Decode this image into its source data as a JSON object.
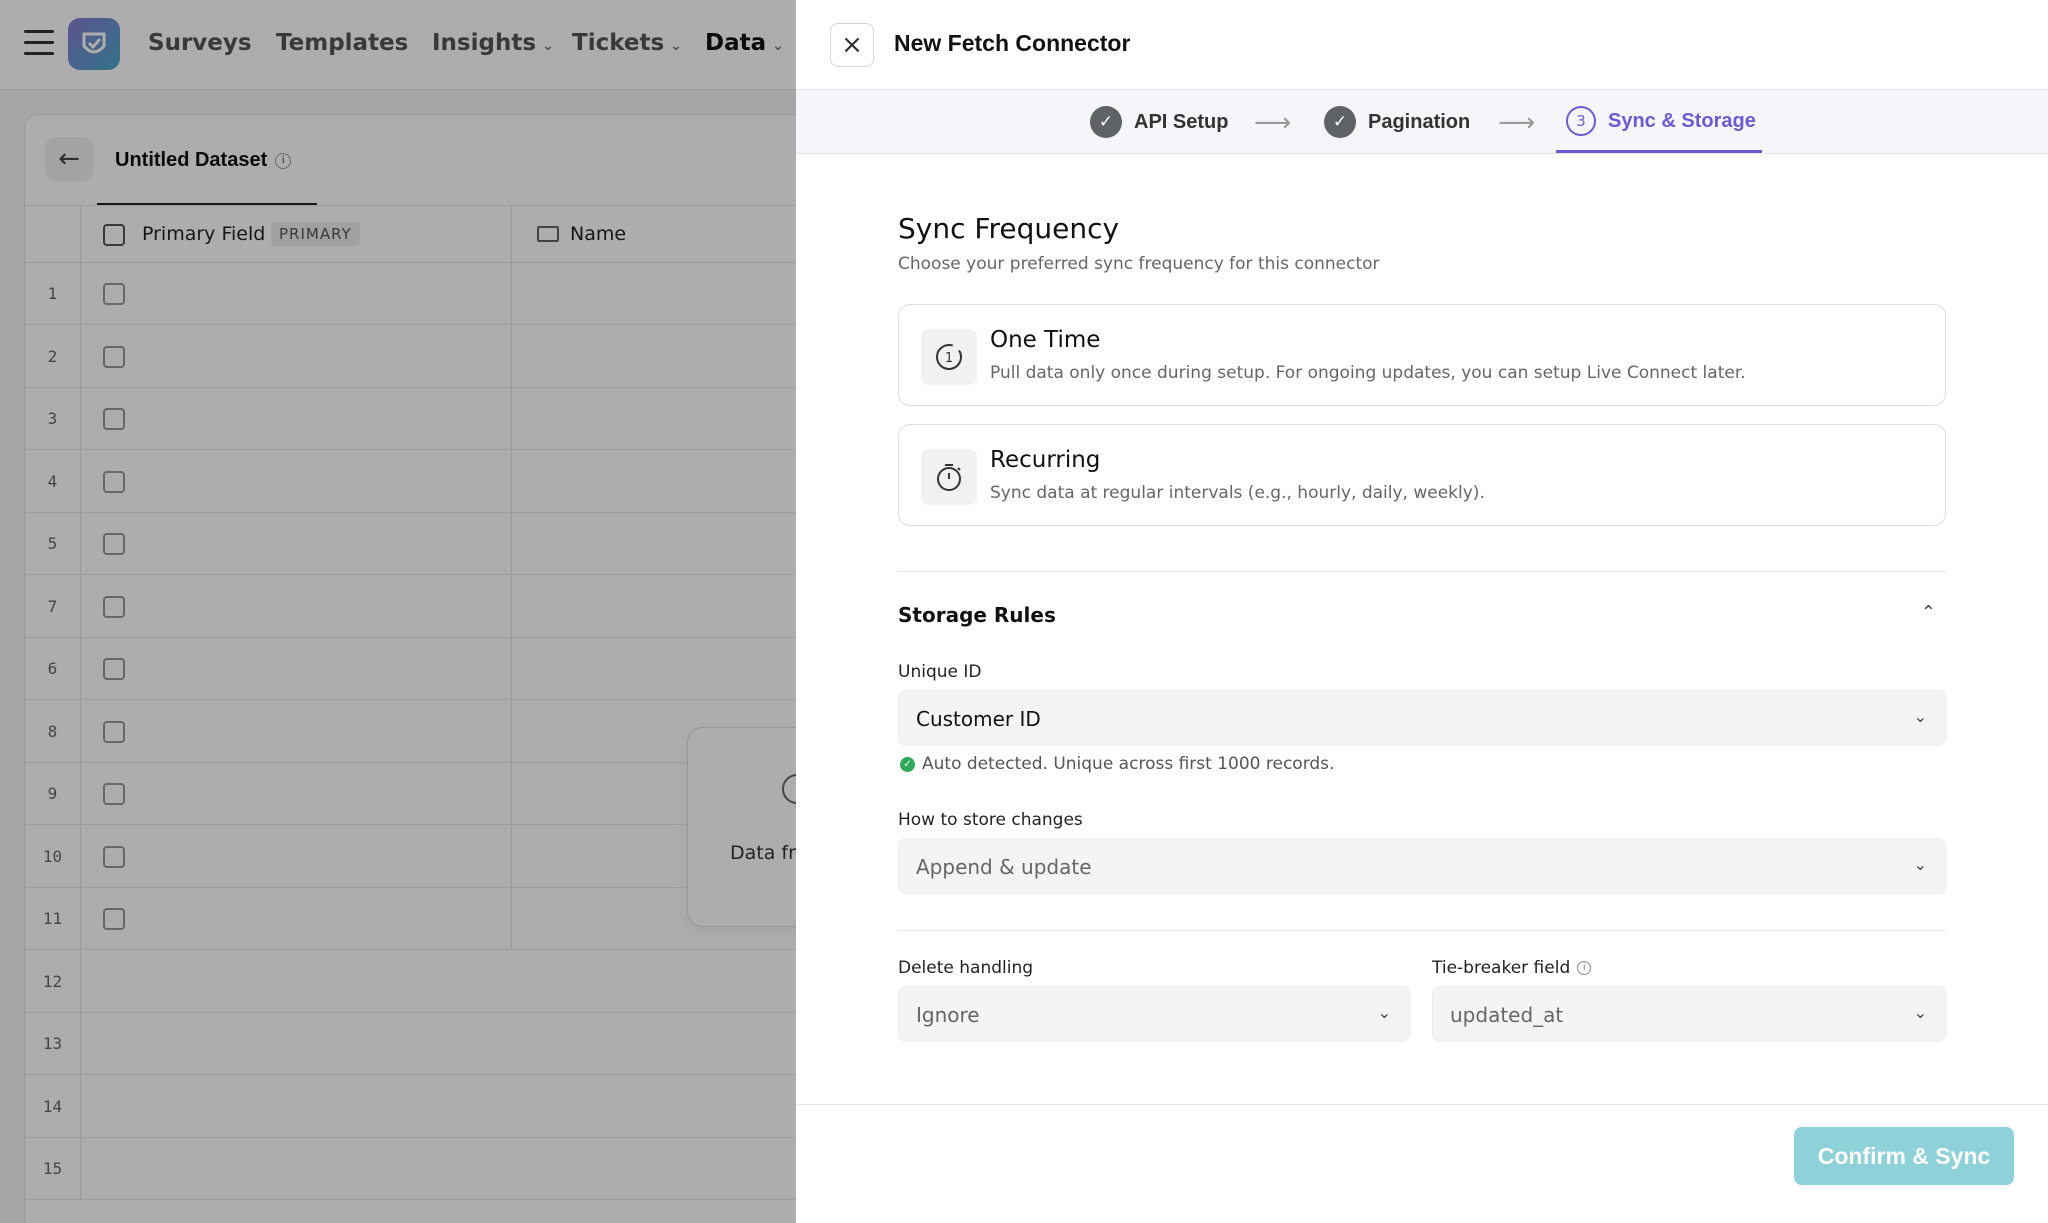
{
  "nav": {
    "items": [
      {
        "label": "Surveys",
        "dropdown": false
      },
      {
        "label": "Templates",
        "dropdown": false
      },
      {
        "label": "Insights",
        "dropdown": true
      },
      {
        "label": "Tickets",
        "dropdown": true
      },
      {
        "label": "Data",
        "dropdown": true,
        "active": true
      }
    ]
  },
  "dataset": {
    "title": "Untitled Dataset",
    "columns": {
      "primary_label": "Primary Field",
      "primary_badge": "PRIMARY",
      "name_label": "Name"
    },
    "row_numbers": [
      "1",
      "2",
      "3",
      "4",
      "5",
      "7",
      "6",
      "8",
      "9",
      "10",
      "11",
      "12",
      "13",
      "14",
      "15"
    ],
    "empty_state_text": "Data fr"
  },
  "drawer": {
    "title": "New Fetch Connector",
    "steps": [
      {
        "label": "API Setup",
        "status": "done"
      },
      {
        "label": "Pagination",
        "status": "done"
      },
      {
        "number": "3",
        "label": "Sync & Storage",
        "status": "active"
      }
    ],
    "sync": {
      "title": "Sync Frequency",
      "subtitle": "Choose your preferred sync frequency for this connector",
      "options": [
        {
          "icon": "clock-one-icon",
          "title": "One Time",
          "description": "Pull data only once during setup. For ongoing updates, you can setup Live Connect later."
        },
        {
          "icon": "stopwatch-icon",
          "title": "Recurring",
          "description": "Sync data at regular intervals (e.g., hourly, daily, weekly)."
        }
      ]
    },
    "storage": {
      "title": "Storage Rules",
      "unique_id": {
        "label": "Unique ID",
        "value": "Customer ID",
        "note": "Auto detected. Unique across first 1000 records."
      },
      "store_changes": {
        "label": "How to store changes",
        "value": "Append & update"
      },
      "delete_handling": {
        "label": "Delete handling",
        "value": "Ignore"
      },
      "tie_breaker": {
        "label": "Tie-breaker field",
        "value": "updated_at"
      }
    },
    "footer": {
      "confirm_label": "Confirm & Sync"
    }
  },
  "colors": {
    "accent": "#6b5bd2",
    "confirm_button": "#8fd1d8",
    "success": "#2eaa5a"
  }
}
